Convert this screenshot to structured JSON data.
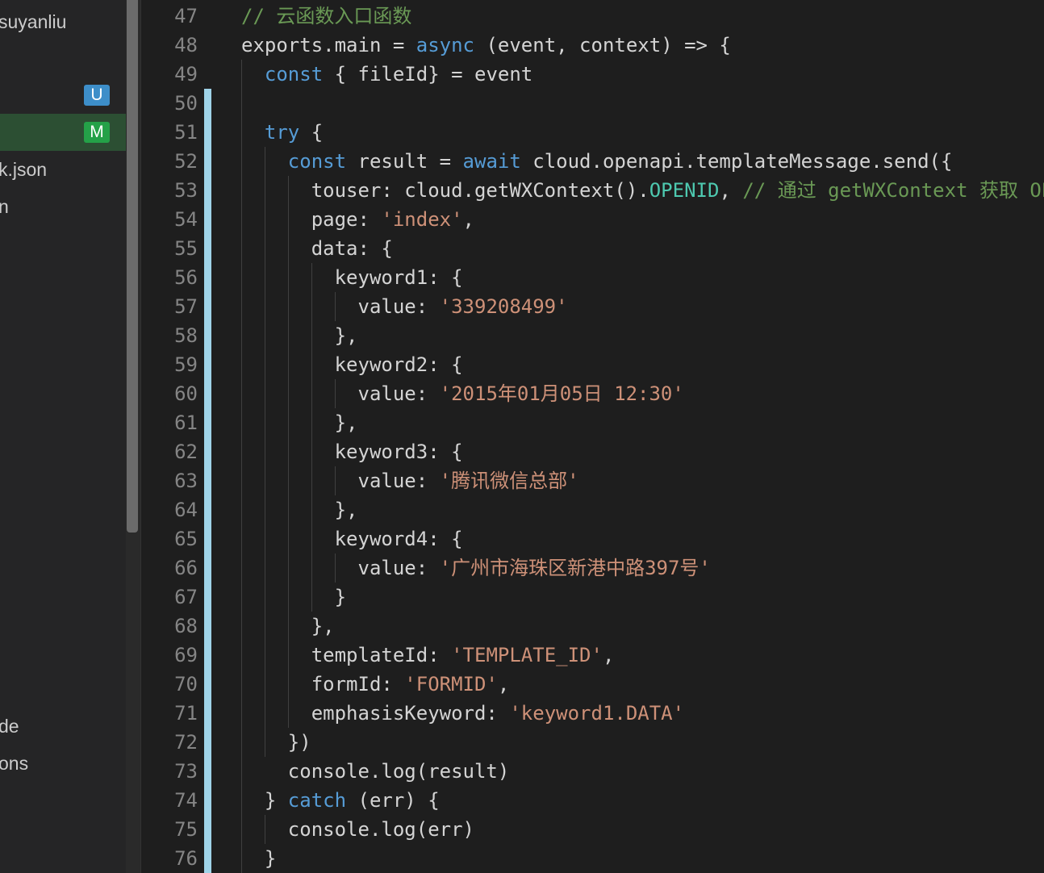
{
  "sidebar": {
    "items": [
      {
        "label": "suyanliu",
        "badge": ""
      },
      {
        "label": "",
        "badge": ""
      },
      {
        "label": "",
        "badge": "U"
      },
      {
        "label": "",
        "badge": "M"
      },
      {
        "label": "k.json",
        "badge": ""
      },
      {
        "label": "n",
        "badge": ""
      },
      {
        "label": "de",
        "badge": ""
      },
      {
        "label": "ons",
        "badge": ""
      }
    ]
  },
  "editor": {
    "lines": [
      {
        "n": "47",
        "tokens": [
          {
            "t": "// 云函数入口函数",
            "c": "comment"
          }
        ]
      },
      {
        "n": "48",
        "tokens": [
          {
            "t": "exports.main = ",
            "c": "plain"
          },
          {
            "t": "async",
            "c": "kw"
          },
          {
            "t": " (event, context) => {",
            "c": "plain"
          }
        ]
      },
      {
        "n": "49",
        "tokens": [
          {
            "t": "  ",
            "c": "plain"
          },
          {
            "t": "const",
            "c": "kw"
          },
          {
            "t": " { fileId} = event",
            "c": "plain"
          }
        ]
      },
      {
        "n": "50",
        "tokens": []
      },
      {
        "n": "51",
        "tokens": [
          {
            "t": "  ",
            "c": "plain"
          },
          {
            "t": "try",
            "c": "kw"
          },
          {
            "t": " {",
            "c": "plain"
          }
        ]
      },
      {
        "n": "52",
        "tokens": [
          {
            "t": "    ",
            "c": "plain"
          },
          {
            "t": "const",
            "c": "kw"
          },
          {
            "t": " result = ",
            "c": "plain"
          },
          {
            "t": "await",
            "c": "kw"
          },
          {
            "t": " cloud.openapi.templateMessage.send({",
            "c": "plain"
          }
        ]
      },
      {
        "n": "53",
        "tokens": [
          {
            "t": "      touser: cloud.getWXContext().",
            "c": "plain"
          },
          {
            "t": "OPENID",
            "c": "const"
          },
          {
            "t": ", ",
            "c": "plain"
          },
          {
            "t": "// 通过 getWXContext 获取 OPENID",
            "c": "comment"
          }
        ]
      },
      {
        "n": "54",
        "tokens": [
          {
            "t": "      page: ",
            "c": "plain"
          },
          {
            "t": "'index'",
            "c": "str"
          },
          {
            "t": ",",
            "c": "plain"
          }
        ]
      },
      {
        "n": "55",
        "tokens": [
          {
            "t": "      data: {",
            "c": "plain"
          }
        ]
      },
      {
        "n": "56",
        "tokens": [
          {
            "t": "        keyword1: {",
            "c": "plain"
          }
        ]
      },
      {
        "n": "57",
        "tokens": [
          {
            "t": "          value: ",
            "c": "plain"
          },
          {
            "t": "'339208499'",
            "c": "str"
          }
        ]
      },
      {
        "n": "58",
        "tokens": [
          {
            "t": "        },",
            "c": "plain"
          }
        ]
      },
      {
        "n": "59",
        "tokens": [
          {
            "t": "        keyword2: {",
            "c": "plain"
          }
        ]
      },
      {
        "n": "60",
        "tokens": [
          {
            "t": "          value: ",
            "c": "plain"
          },
          {
            "t": "'2015年01月05日 12:30'",
            "c": "str"
          }
        ]
      },
      {
        "n": "61",
        "tokens": [
          {
            "t": "        },",
            "c": "plain"
          }
        ]
      },
      {
        "n": "62",
        "tokens": [
          {
            "t": "        keyword3: {",
            "c": "plain"
          }
        ]
      },
      {
        "n": "63",
        "tokens": [
          {
            "t": "          value: ",
            "c": "plain"
          },
          {
            "t": "'腾讯微信总部'",
            "c": "str"
          }
        ]
      },
      {
        "n": "64",
        "tokens": [
          {
            "t": "        },",
            "c": "plain"
          }
        ]
      },
      {
        "n": "65",
        "tokens": [
          {
            "t": "        keyword4: {",
            "c": "plain"
          }
        ]
      },
      {
        "n": "66",
        "tokens": [
          {
            "t": "          value: ",
            "c": "plain"
          },
          {
            "t": "'广州市海珠区新港中路397号'",
            "c": "str"
          }
        ]
      },
      {
        "n": "67",
        "tokens": [
          {
            "t": "        }",
            "c": "plain"
          }
        ]
      },
      {
        "n": "68",
        "tokens": [
          {
            "t": "      },",
            "c": "plain"
          }
        ]
      },
      {
        "n": "69",
        "tokens": [
          {
            "t": "      templateId: ",
            "c": "plain"
          },
          {
            "t": "'TEMPLATE_ID'",
            "c": "str"
          },
          {
            "t": ",",
            "c": "plain"
          }
        ]
      },
      {
        "n": "70",
        "tokens": [
          {
            "t": "      formId: ",
            "c": "plain"
          },
          {
            "t": "'FORMID'",
            "c": "str"
          },
          {
            "t": ",",
            "c": "plain"
          }
        ]
      },
      {
        "n": "71",
        "tokens": [
          {
            "t": "      emphasisKeyword: ",
            "c": "plain"
          },
          {
            "t": "'keyword1.DATA'",
            "c": "str"
          }
        ]
      },
      {
        "n": "72",
        "tokens": [
          {
            "t": "    })",
            "c": "plain"
          }
        ]
      },
      {
        "n": "73",
        "tokens": [
          {
            "t": "    console.log(result)",
            "c": "plain"
          }
        ]
      },
      {
        "n": "74",
        "tokens": [
          {
            "t": "  } ",
            "c": "plain"
          },
          {
            "t": "catch",
            "c": "kw"
          },
          {
            "t": " (err) {",
            "c": "plain"
          }
        ]
      },
      {
        "n": "75",
        "tokens": [
          {
            "t": "    console.log(err)",
            "c": "plain"
          }
        ]
      },
      {
        "n": "76",
        "tokens": [
          {
            "t": "  }",
            "c": "plain"
          }
        ]
      }
    ]
  }
}
